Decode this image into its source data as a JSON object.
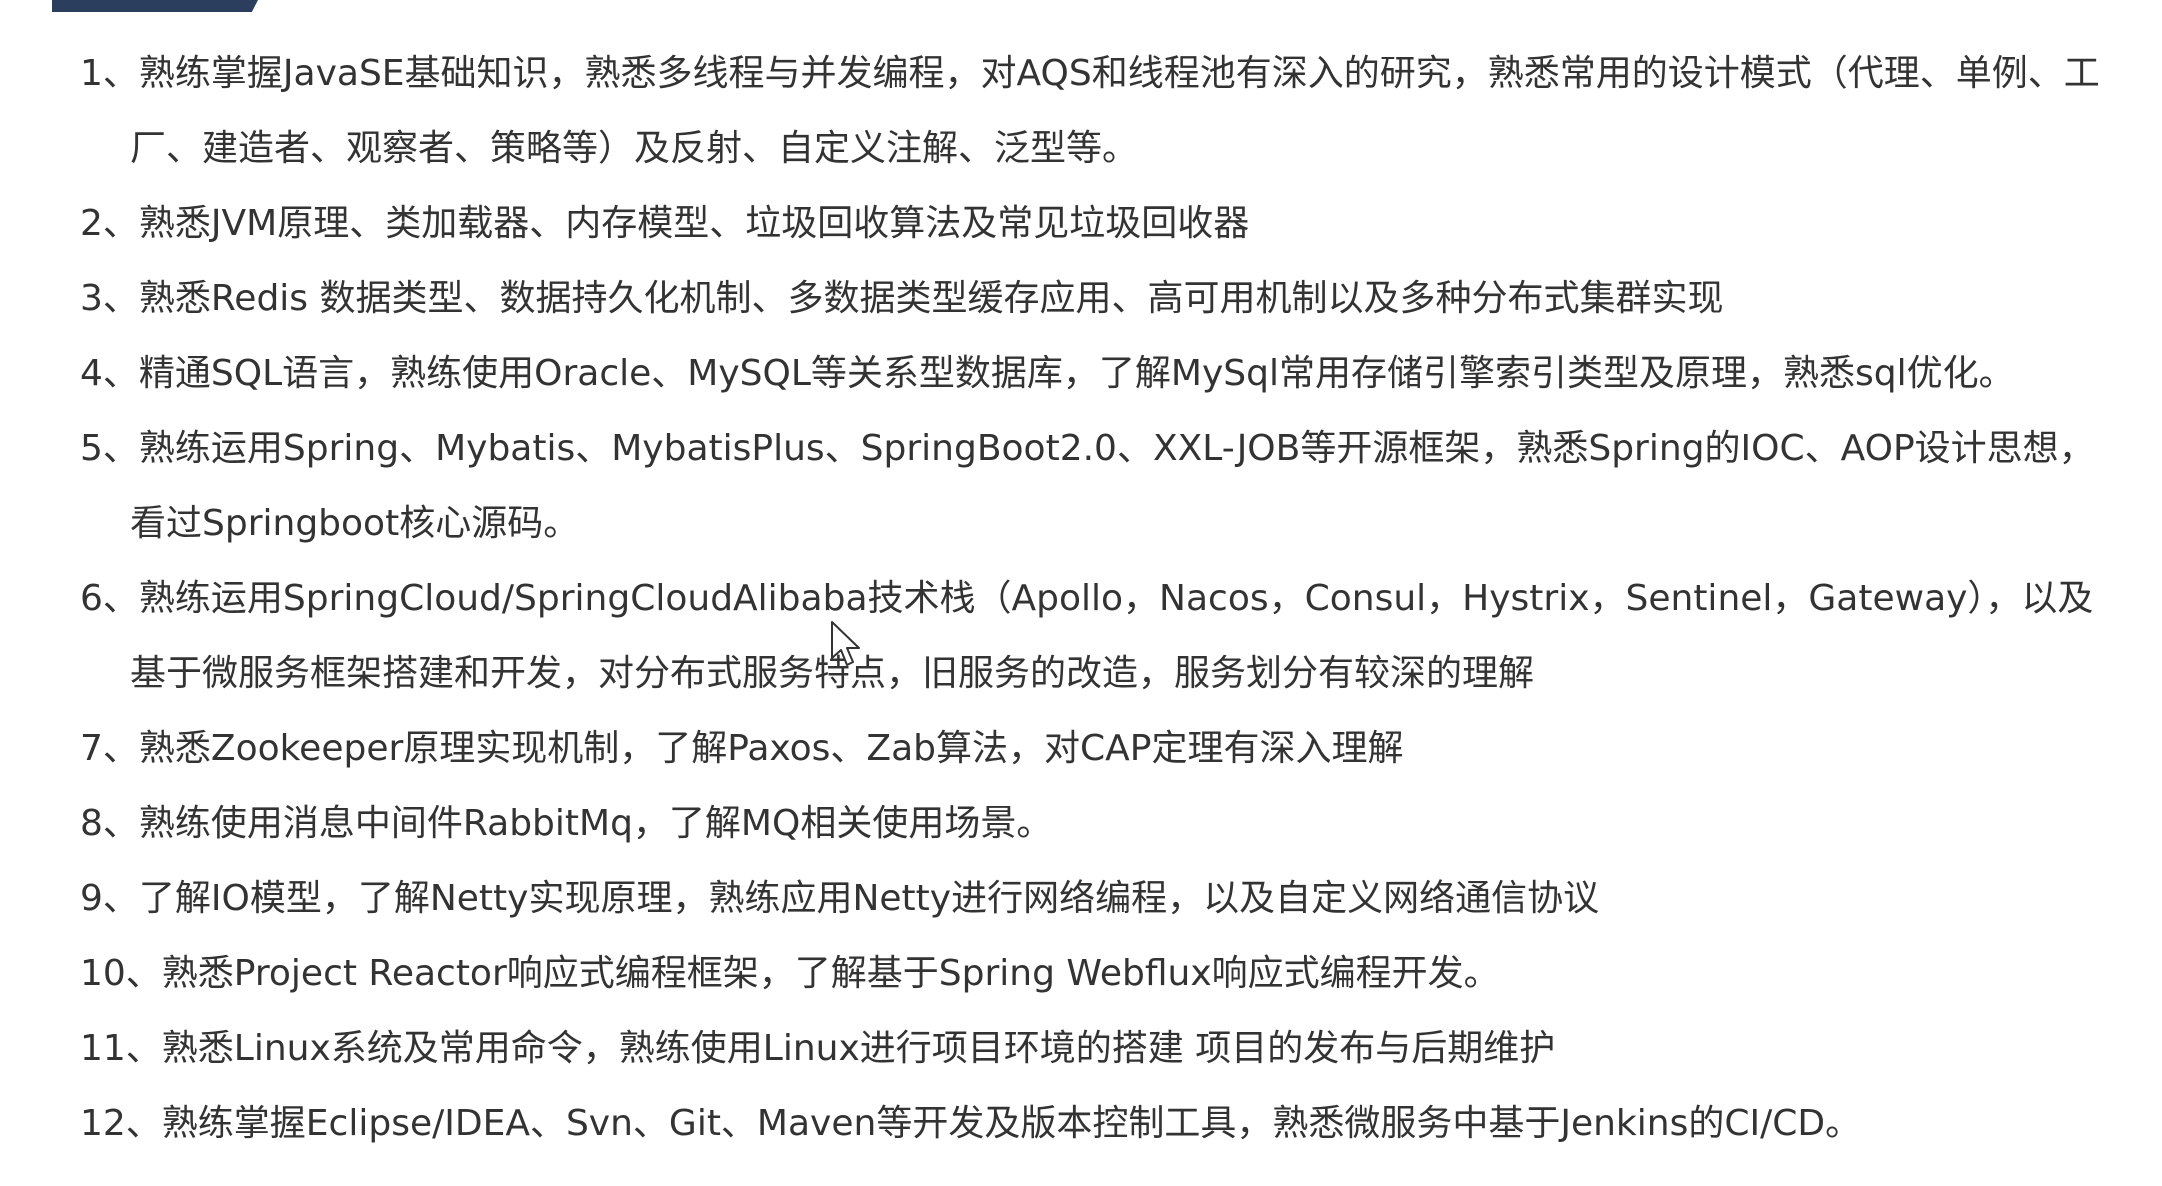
{
  "skills": [
    "1、熟练掌握JavaSE基础知识，熟悉多线程与并发编程，对AQS和线程池有深入的研究，熟悉常用的设计模式（代理、单例、工厂、建造者、观察者、策略等）及反射、自定义注解、泛型等。",
    "2、熟悉JVM原理、类加载器、内存模型、垃圾回收算法及常见垃圾回收器",
    "3、熟悉Redis 数据类型、数据持久化机制、多数据类型缓存应用、高可用机制以及多种分布式集群实现",
    "4、精通SQL语言，熟练使用Oracle、MySQL等关系型数据库，了解MySql常用存储引擎索引类型及原理，熟悉sql优化。",
    "5、熟练运用Spring、Mybatis、MybatisPlus、SpringBoot2.0、XXL-JOB等开源框架，熟悉Spring的IOC、AOP设计思想，看过Springboot核心源码。",
    "6、熟练运用SpringCloud/SpringCloudAlibaba技术栈（Apollo，Nacos，Consul，Hystrix，Sentinel，Gateway），以及基于微服务框架搭建和开发，对分布式服务特点，旧服务的改造，服务划分有较深的理解",
    "7、熟悉Zookeeper原理实现机制，了解Paxos、Zab算法，对CAP定理有深入理解",
    "8、熟练使用消息中间件RabbitMq，了解MQ相关使用场景。",
    "9、了解IO模型，了解Netty实现原理，熟练应用Netty进行网络编程，以及自定义网络通信协议",
    "10、熟悉Project Reactor响应式编程框架，了解基于Spring Webflux响应式编程开发。",
    "11、熟悉Linux系统及常用命令，熟练使用Linux进行项目环境的搭建 项目的发布与后期维护",
    "12、熟练掌握Eclipse/IDEA、Svn、Git、Maven等开发及版本控制工具，熟悉微服务中基于Jenkins的CI/CD。"
  ],
  "colors": {
    "text": "#333333",
    "accent": "#2c3e5e",
    "background": "#ffffff"
  },
  "icons": {
    "cursor": "mouse-pointer-icon"
  }
}
